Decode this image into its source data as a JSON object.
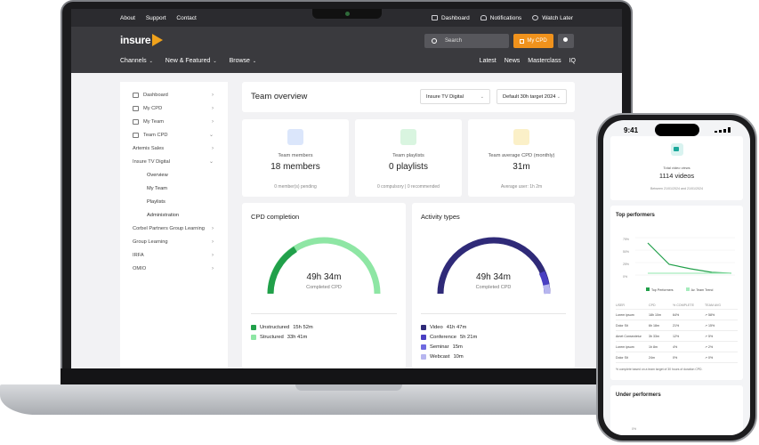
{
  "topbar": {
    "links": [
      "About",
      "Support",
      "Contact"
    ],
    "right": [
      "Dashboard",
      "Notifications",
      "Watch Later"
    ]
  },
  "header": {
    "logo_text": "insure",
    "logo_badge": "tv",
    "search_placeholder": "Search",
    "mycpd_label": "My CPD",
    "nav": [
      "Channels",
      "New & Featured",
      "Browse"
    ],
    "nav_right": [
      "Latest",
      "News",
      "Masterclass",
      "IQ"
    ]
  },
  "sidebar": {
    "items": [
      {
        "label": "Dashboard"
      },
      {
        "label": "My CPD"
      },
      {
        "label": "My Team"
      },
      {
        "label": "Team CPD"
      },
      {
        "label": "Artemis Sales"
      },
      {
        "label": "Insure TV Digital"
      }
    ],
    "subitems": [
      "Overview",
      "My Team",
      "Playlists",
      "Administration"
    ],
    "more": [
      "Corbel Partners Group Learning",
      "Group Learning",
      "IRFA",
      "OMIO"
    ]
  },
  "main": {
    "title": "Team overview",
    "select_org": "Insure TV Digital",
    "select_target": "Default 30h target 2024",
    "cards": [
      {
        "label": "Team members",
        "value": "18 members",
        "sub": "0 member(s) pending"
      },
      {
        "label": "Team playlists",
        "value": "0 playlists",
        "sub": "0 compulsory | 0 recommended"
      },
      {
        "label": "Team average CPD (monthly)",
        "value": "31m",
        "sub": "Average user: 1h 2m"
      }
    ],
    "cpd": {
      "title": "CPD completion",
      "value": "49h 34m",
      "sub": "Completed CPD",
      "legend": [
        {
          "label": "Unstructured",
          "value": "15h 52m",
          "color": "#21a04a"
        },
        {
          "label": "Structured",
          "value": "33h 41m",
          "color": "#8ee6a4"
        }
      ]
    },
    "activity": {
      "title": "Activity types",
      "value": "49h 34m",
      "sub": "Completed CPD",
      "legend": [
        {
          "label": "Video",
          "value": "41h 47m",
          "color": "#2f2a78"
        },
        {
          "label": "Conference",
          "value": "5h 21m",
          "color": "#4a3fc2"
        },
        {
          "label": "Seminar",
          "value": "15m",
          "color": "#6f6ae0"
        },
        {
          "label": "Webcast",
          "value": "10m",
          "color": "#b7b6ef"
        }
      ]
    }
  },
  "phone": {
    "time": "9:41",
    "videos_label": "Total video views",
    "videos_value": "1114 videos",
    "videos_range": "Between 21/01/2024 and 21/01/2024",
    "top_title": "Top performers",
    "y_ticks": [
      "75%",
      "50%",
      "25%",
      "0%"
    ],
    "legend": [
      "Top Performers",
      "Av. Team Trend"
    ],
    "table_headers": [
      "USER",
      "CPD",
      "% COMPLETE",
      "TEAM AVG"
    ],
    "rows": [
      [
        "Lorem ipsum",
        "18h 10m",
        "64%",
        "↗ 58%"
      ],
      [
        "Dolor Sit",
        "6h 18m",
        "21%",
        "↗ 15%"
      ],
      [
        "Amet Consectetur",
        "3h 33m",
        "12%",
        "↗ 5%"
      ],
      [
        "Lorem ipsum",
        "1h 8m",
        "4%",
        "↗ 2%"
      ],
      [
        "Dolor Sit",
        "24m",
        "0%",
        "↗ 0%"
      ]
    ],
    "footnote": "% complete based on a team target of 30 hours of duration CPD.",
    "under_title": "Under performers",
    "under_tick": "0%"
  }
}
